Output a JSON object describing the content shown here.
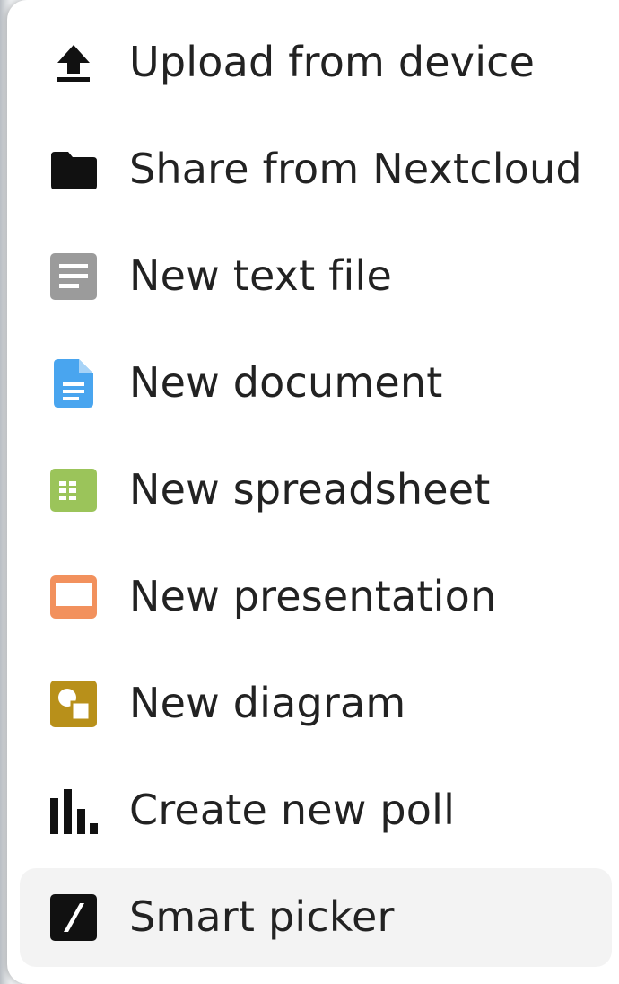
{
  "menu": {
    "items": [
      {
        "label": "Upload from device",
        "icon": "upload-icon",
        "color": "#111111"
      },
      {
        "label": "Share from Nextcloud",
        "icon": "folder-icon",
        "color": "#111111"
      },
      {
        "label": "New text file",
        "icon": "text-file-icon",
        "color": "#9b9b9b"
      },
      {
        "label": "New document",
        "icon": "document-icon",
        "color": "#49a5ef"
      },
      {
        "label": "New spreadsheet",
        "icon": "spreadsheet-icon",
        "color": "#9bc45a"
      },
      {
        "label": "New presentation",
        "icon": "presentation-icon",
        "color": "#f2915d"
      },
      {
        "label": "New diagram",
        "icon": "diagram-icon",
        "color": "#b8901a"
      },
      {
        "label": "Create new poll",
        "icon": "poll-icon",
        "color": "#111111"
      },
      {
        "label": "Smart picker",
        "icon": "smart-picker-icon",
        "color": "#111111",
        "highlighted": true
      }
    ]
  }
}
